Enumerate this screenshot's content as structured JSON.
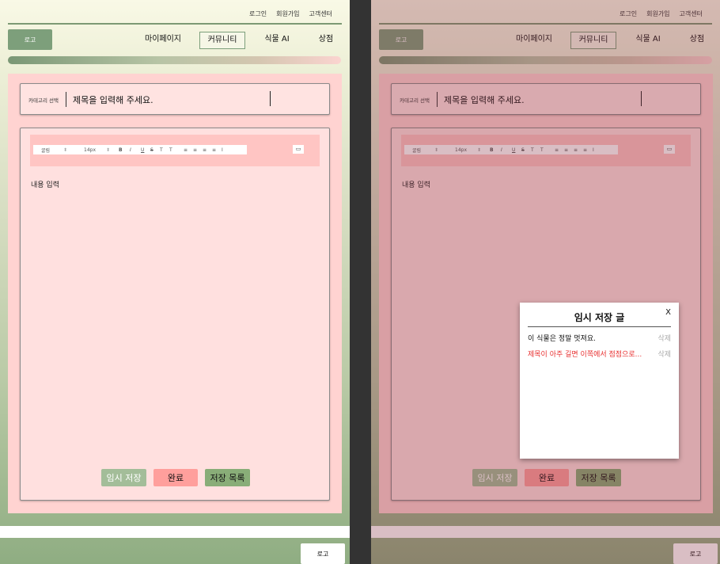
{
  "header": {
    "top_links": [
      "로그인",
      "회원가입",
      "고객센터"
    ],
    "logo": "로고",
    "nav": [
      "마이페이지",
      "커뮤니티",
      "식물 AI",
      "상점"
    ]
  },
  "form": {
    "category": "카테고리 선택",
    "title_placeholder": "제목을 입력해 주세요.",
    "toolbar": {
      "font": "굴림",
      "size": "14px",
      "format_glyphs": [
        "B",
        "I",
        "U",
        "S",
        "T",
        "T"
      ],
      "align_glyphs": [
        "≡",
        "≡",
        "≡",
        "≡",
        "I"
      ],
      "image_glyph": "▭"
    },
    "content_placeholder": "내용 입력",
    "buttons": {
      "temp_save": "임시 저장",
      "done": "완료",
      "saved_list": "저장 목록"
    }
  },
  "footer": {
    "logo": "로고"
  },
  "modal": {
    "title": "임시 저장 글",
    "close": "X",
    "items": [
      {
        "text": "이 식물은 정말 멋져요.",
        "delete": "삭제",
        "color": "#111111"
      },
      {
        "text": "제목이 아주 길면 이쪽에서 점점으로...",
        "delete": "삭제",
        "color": "#e83030"
      }
    ]
  },
  "colors": {
    "accent_green": "#7d9f7b",
    "form_bg": "#ffd3d1",
    "done_button": "#ff9f9c"
  }
}
